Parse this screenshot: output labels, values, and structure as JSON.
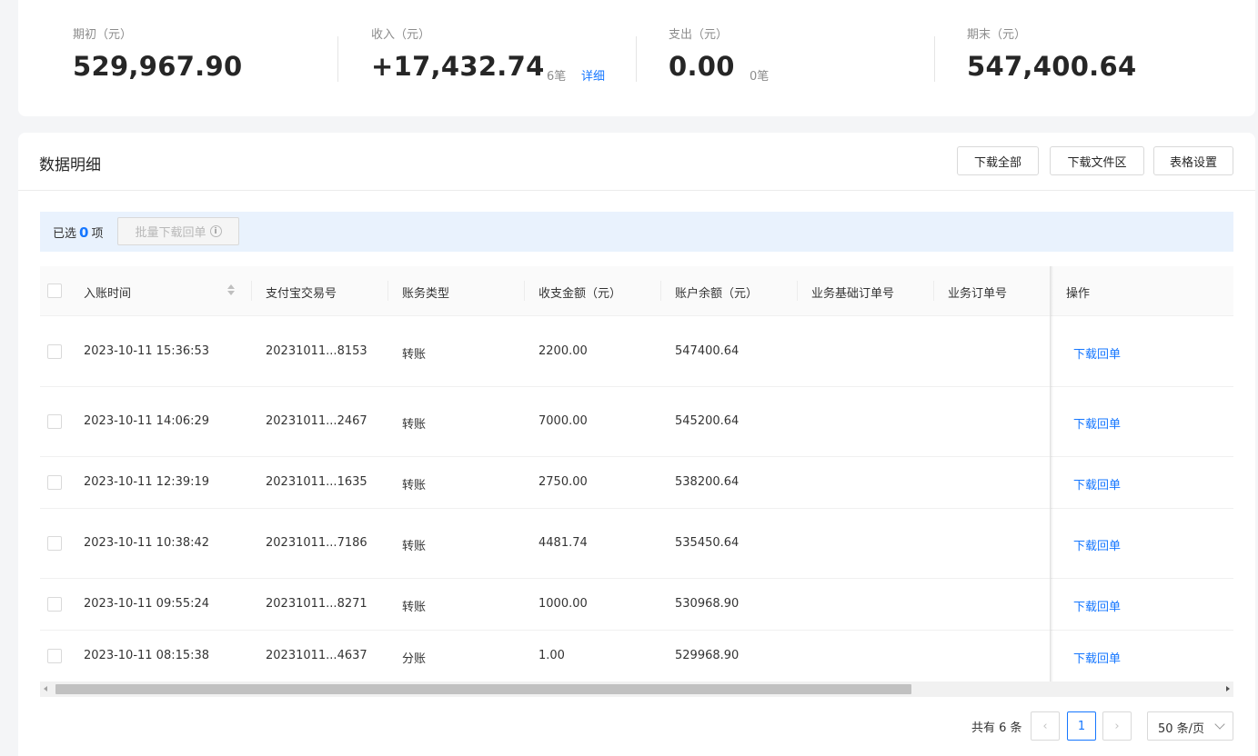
{
  "summary": {
    "opening": {
      "label": "期初（元）",
      "value": "529,967.90"
    },
    "income": {
      "label": "收入（元）",
      "value": "+17,432.74",
      "count": "6笔",
      "detail_link": "详细"
    },
    "expense": {
      "label": "支出（元）",
      "value": "0.00",
      "count": "0笔"
    },
    "closing": {
      "label": "期末（元）",
      "value": "547,400.64"
    }
  },
  "detail": {
    "title": "数据明细",
    "buttons": {
      "download_all": "下载全部",
      "download_area": "下载文件区",
      "table_settings": "表格设置"
    },
    "selection": {
      "prefix": "已选",
      "count": "0",
      "suffix": "项",
      "batch_download": "批量下载回单"
    }
  },
  "table": {
    "headers": [
      "入账时间",
      "支付宝交易号",
      "账务类型",
      "收支金额（元）",
      "账户余额（元）",
      "业务基础订单号",
      "业务订单号",
      "操作"
    ],
    "rows": [
      {
        "time": "2023-10-11 15:36:53",
        "txn": "20231011...8153",
        "type": "转账",
        "amount": "2200.00",
        "balance": "547400.64",
        "action": "下载回单"
      },
      {
        "time": "2023-10-11 14:06:29",
        "txn": "20231011...2467",
        "type": "转账",
        "amount": "7000.00",
        "balance": "545200.64",
        "action": "下载回单"
      },
      {
        "time": "2023-10-11 12:39:19",
        "txn": "20231011...1635",
        "type": "转账",
        "amount": "2750.00",
        "balance": "538200.64",
        "action": "下载回单"
      },
      {
        "time": "2023-10-11 10:38:42",
        "txn": "20231011...7186",
        "type": "转账",
        "amount": "4481.74",
        "balance": "535450.64",
        "action": "下载回单"
      },
      {
        "time": "2023-10-11 09:55:24",
        "txn": "20231011...8271",
        "type": "转账",
        "amount": "1000.00",
        "balance": "530968.90",
        "action": "下载回单"
      },
      {
        "time": "2023-10-11 08:15:38",
        "txn": "20231011...4637",
        "type": "分账",
        "amount": "1.00",
        "balance": "529968.90",
        "action": "下载回单"
      }
    ]
  },
  "pagination": {
    "total": "共有 6 条",
    "prev": "‹",
    "current": "1",
    "next": "›",
    "page_size": "50 条/页"
  },
  "colors": {
    "accent": "#1677ff",
    "selection_bar": "#e9f2fd",
    "page_bg": "#f4f5f7"
  }
}
